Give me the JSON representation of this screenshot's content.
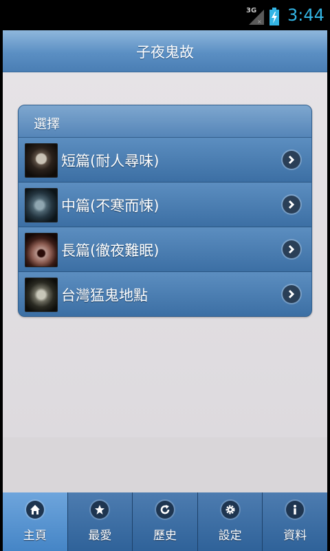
{
  "status": {
    "network": "3G",
    "time": "3:44"
  },
  "header": {
    "title": "子夜鬼故"
  },
  "list": {
    "heading": "選擇",
    "items": [
      {
        "label": "短篇(耐人尋味)"
      },
      {
        "label": "中篇(不寒而悚)"
      },
      {
        "label": "長篇(徹夜難眠)"
      },
      {
        "label": "台灣猛鬼地點"
      }
    ]
  },
  "tabs": [
    {
      "label": "主頁",
      "icon": "home-icon",
      "active": true
    },
    {
      "label": "最愛",
      "icon": "star-icon",
      "active": false
    },
    {
      "label": "歷史",
      "icon": "refresh-icon",
      "active": false
    },
    {
      "label": "設定",
      "icon": "gear-icon",
      "active": false
    },
    {
      "label": "資料",
      "icon": "info-icon",
      "active": false
    }
  ],
  "colors": {
    "accent": "#5b8fc3",
    "time": "#33b5e5",
    "tab_active": "#4585c6"
  }
}
